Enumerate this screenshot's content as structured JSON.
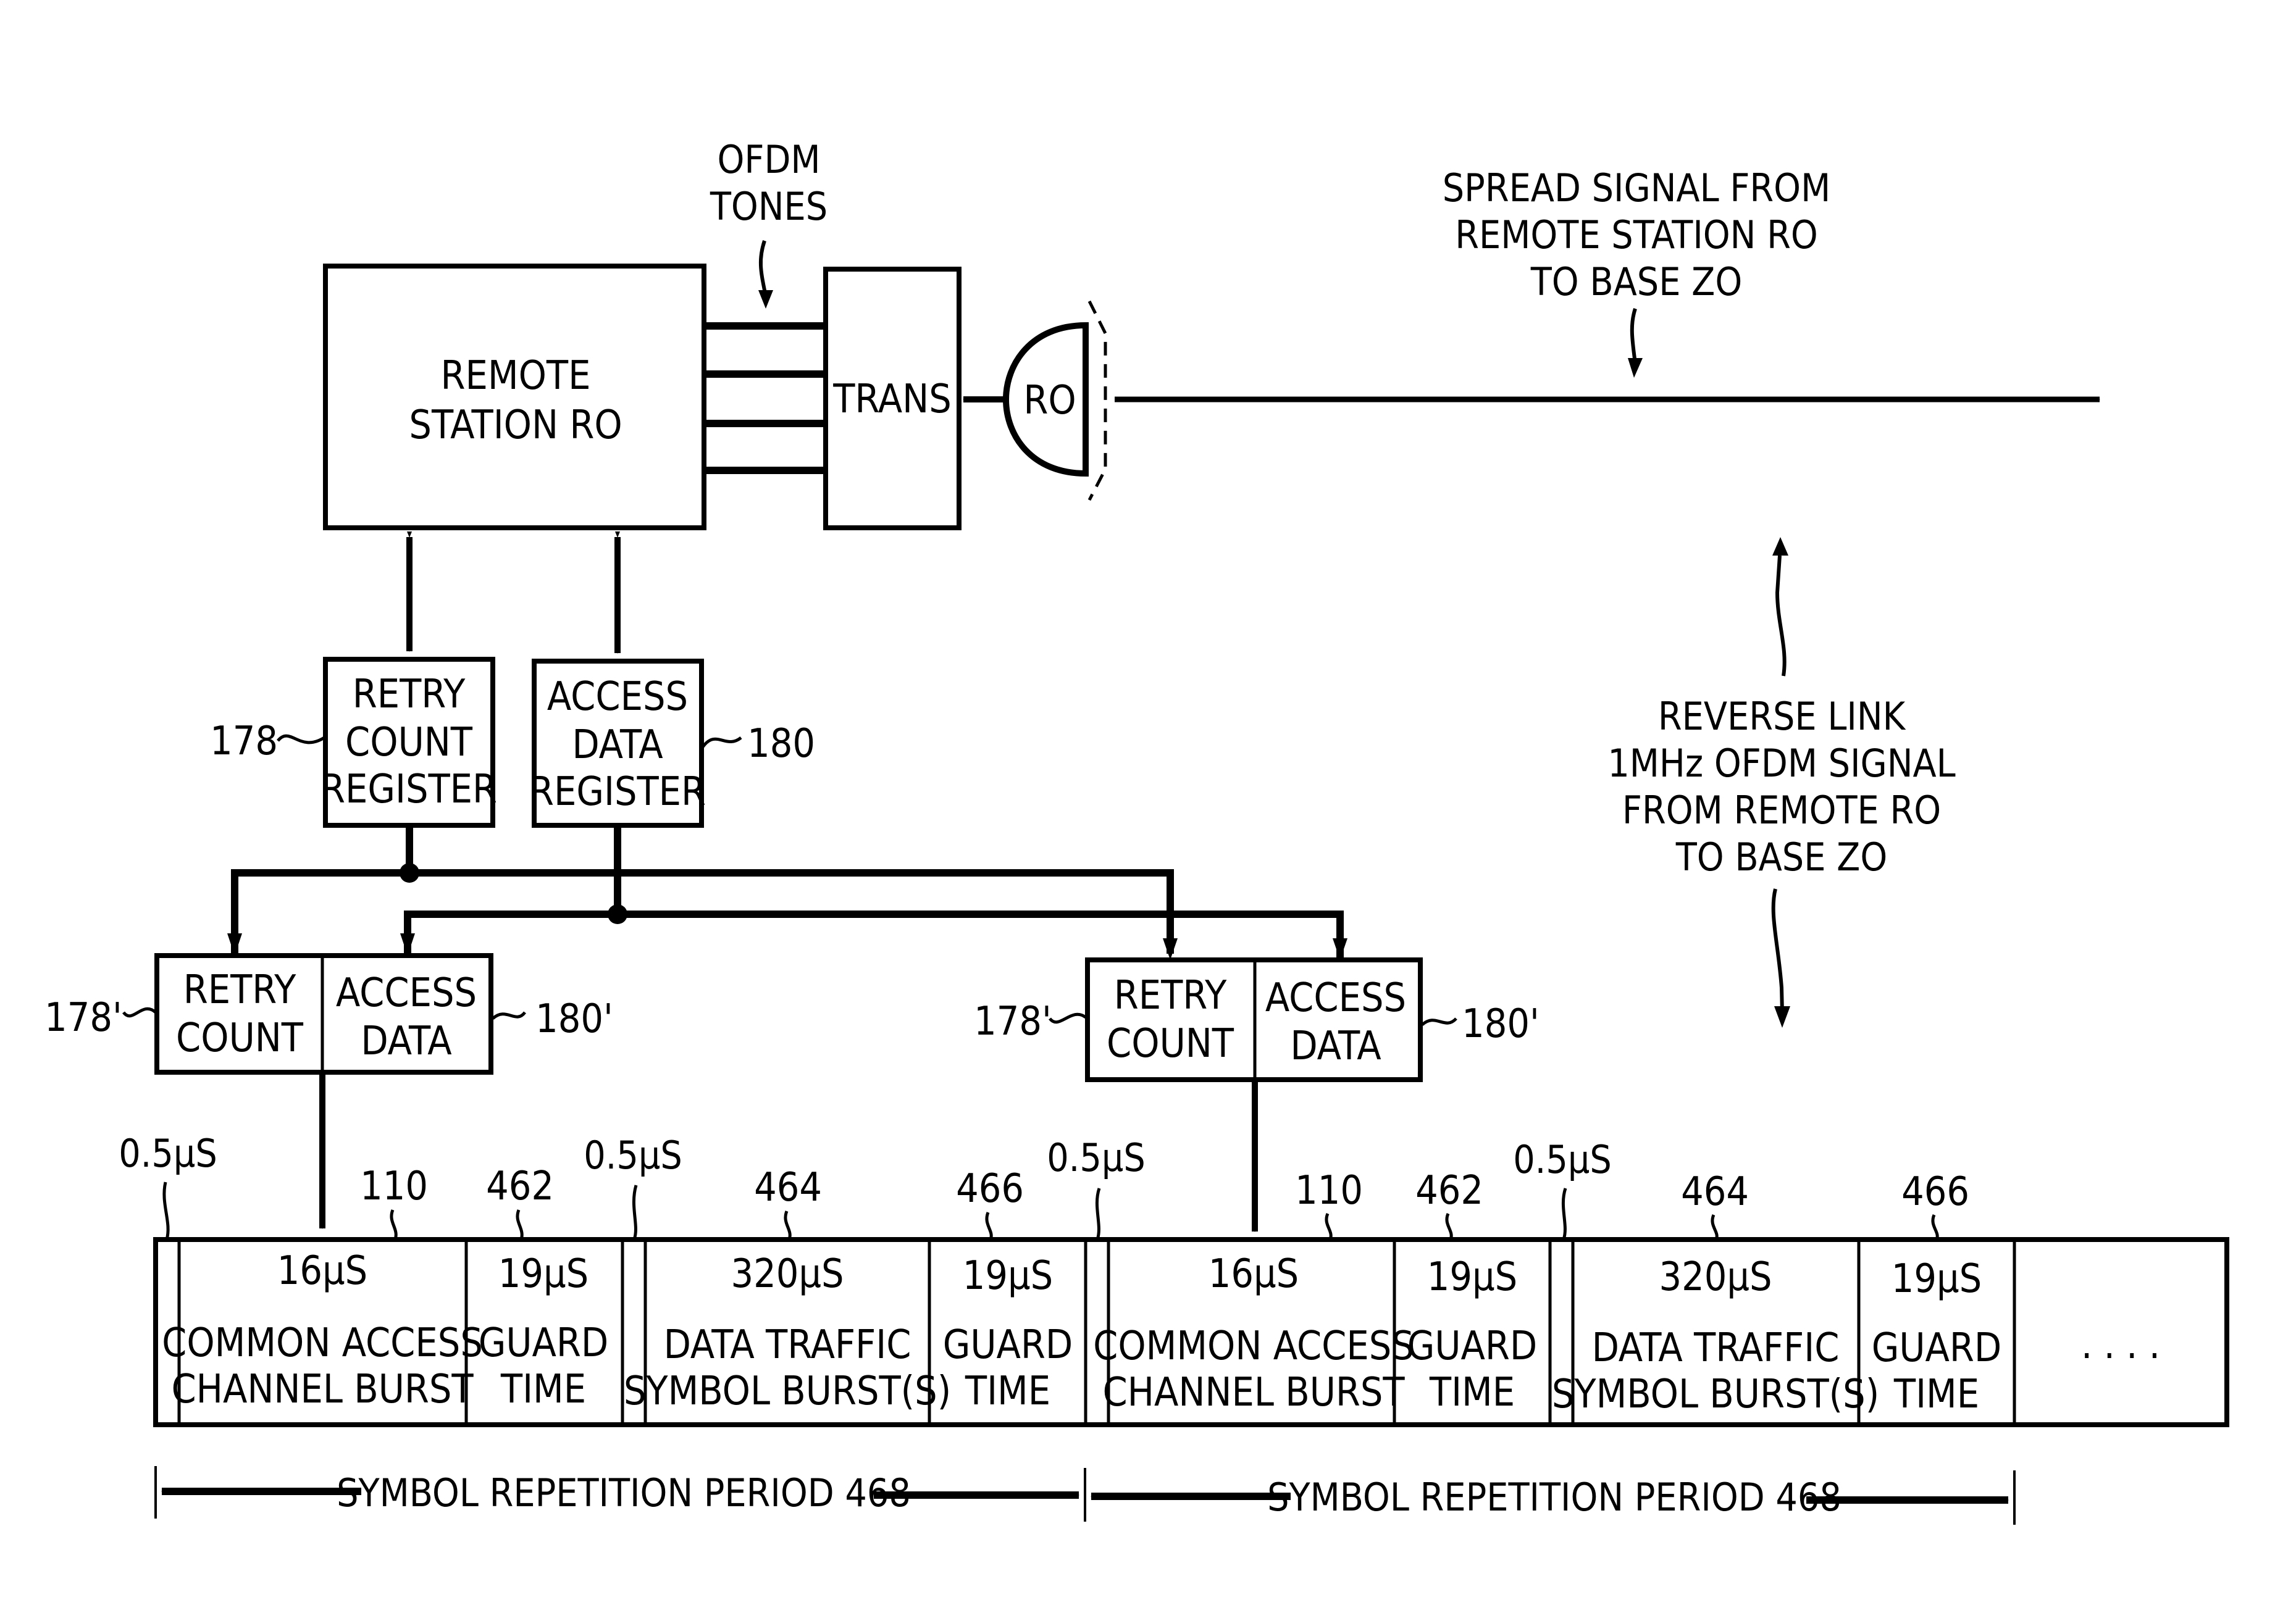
{
  "diagram": {
    "remote_station": {
      "lines": [
        "REMOTE",
        "STATION RO"
      ]
    },
    "ofdm_tones_label": {
      "lines": [
        "OFDM",
        "TONES"
      ]
    },
    "trans_block": {
      "label": "TRANS"
    },
    "antenna": {
      "label": "RO"
    },
    "spread_signal_label": {
      "lines": [
        "SPREAD SIGNAL FROM",
        "REMOTE STATION RO",
        "TO BASE ZO"
      ]
    },
    "reverse_link_label": {
      "lines": [
        "REVERSE LINK",
        "1MHz OFDM SIGNAL",
        "FROM REMOTE RO",
        "TO BASE ZO"
      ]
    },
    "retry_count_register": {
      "lines": [
        "RETRY",
        "COUNT",
        "REGISTER"
      ],
      "ref": "178"
    },
    "access_data_register": {
      "lines": [
        "ACCESS",
        "DATA",
        "REGISTER"
      ],
      "ref": "180"
    },
    "copies": [
      {
        "retry": [
          "RETRY",
          "COUNT"
        ],
        "access": [
          "ACCESS",
          "DATA"
        ],
        "retry_ref": "178'",
        "access_ref": "180'"
      },
      {
        "retry": [
          "RETRY",
          "COUNT"
        ],
        "access": [
          "ACCESS",
          "DATA"
        ],
        "retry_ref": "178'",
        "access_ref": "180'"
      }
    ],
    "frame": {
      "periods": [
        {
          "gap_label": "0.5µS",
          "segments": [
            {
              "ref": "110",
              "duration": "16µS",
              "lines": [
                "COMMON ACCESS",
                "CHANNEL BURST"
              ]
            },
            {
              "ref": "462",
              "duration": "19µS",
              "lines": [
                "GUARD",
                "TIME"
              ]
            }
          ],
          "gap2_label": "0.5µS",
          "segments2": [
            {
              "ref": "464",
              "duration": "320µS",
              "lines": [
                "DATA TRAFFIC",
                "SYMBOL BURST(S)"
              ]
            },
            {
              "ref": "466",
              "duration": "19µS",
              "lines": [
                "GUARD",
                "TIME"
              ]
            }
          ]
        },
        {
          "gap_label": "0.5µS",
          "segments": [
            {
              "ref": "110",
              "duration": "16µS",
              "lines": [
                "COMMON ACCESS",
                "CHANNEL BURST"
              ]
            },
            {
              "ref": "462",
              "duration": "19µS",
              "lines": [
                "GUARD",
                "TIME"
              ]
            }
          ],
          "gap2_label": "0.5µS",
          "segments2": [
            {
              "ref": "464",
              "duration": "320µS",
              "lines": [
                "DATA TRAFFIC",
                "SYMBOL BURST(S)"
              ]
            },
            {
              "ref": "466",
              "duration": "19µS",
              "lines": [
                "GUARD",
                "TIME"
              ]
            }
          ]
        }
      ],
      "continuation": ". . . .",
      "period_label": "SYMBOL REPETITION PERIOD 468"
    }
  }
}
